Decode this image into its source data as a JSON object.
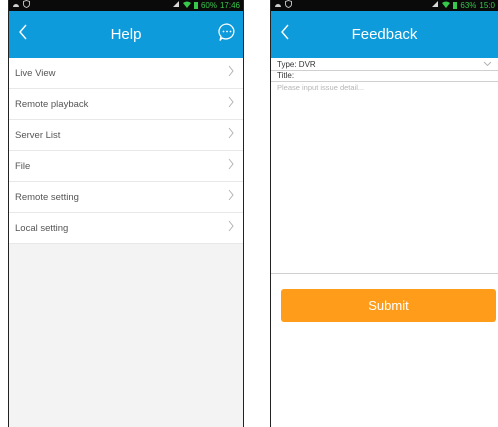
{
  "help_screen": {
    "status": {
      "pct": "60%",
      "time": "17:46"
    },
    "title": "Help",
    "items": [
      {
        "label": "Live View"
      },
      {
        "label": "Remote playback"
      },
      {
        "label": "Server List"
      },
      {
        "label": "File"
      },
      {
        "label": "Remote setting"
      },
      {
        "label": "Local setting"
      }
    ]
  },
  "feedback_screen": {
    "status": {
      "pct": "63%",
      "time": "15:0"
    },
    "title": "Feedback",
    "type_label": "Type: DVR",
    "title_label": "Title:",
    "detail_placeholder": "Please input issue detail...",
    "submit_label": "Submit"
  },
  "colors": {
    "header_blue": "#0e9bdb",
    "submit_orange": "#ff9d1a",
    "status_green": "#37c74a"
  },
  "icons": [
    "android-icon",
    "shield-icon",
    "signal-icon",
    "wifi-icon",
    "battery-icon",
    "back-arrow-icon",
    "message-icon",
    "chevron-right-icon",
    "chevron-down-icon"
  ]
}
